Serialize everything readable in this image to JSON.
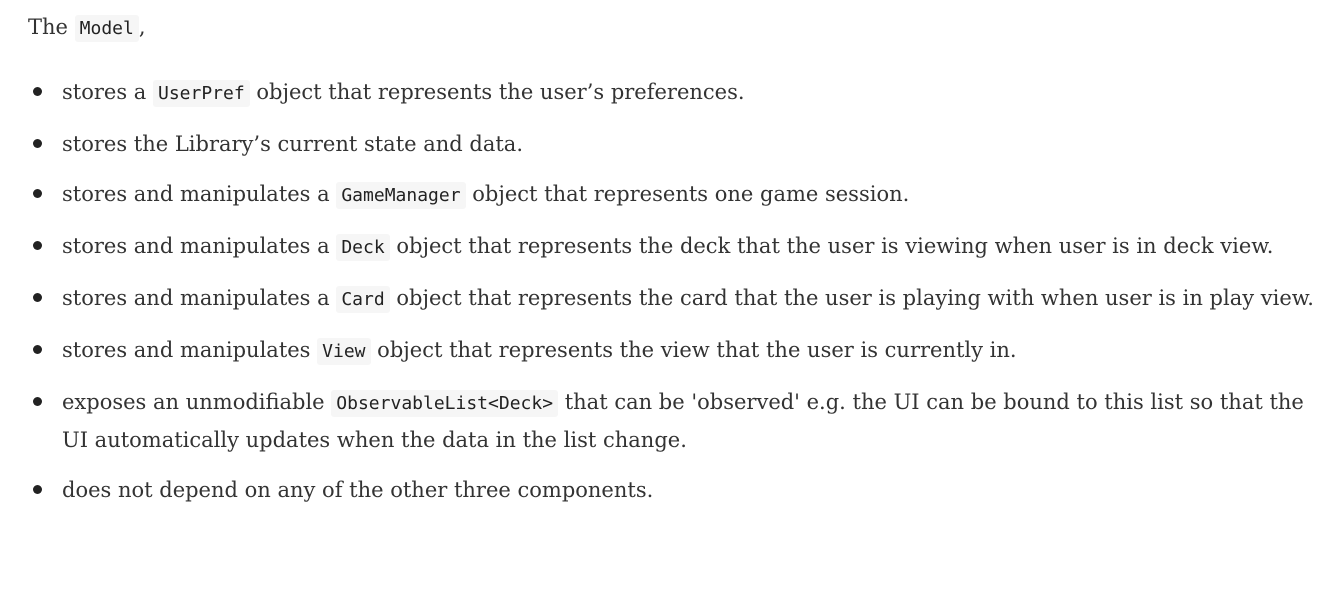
{
  "intro": {
    "before": "The ",
    "code": "Model",
    "after": ","
  },
  "items": [
    {
      "before": "stores a ",
      "code": "UserPref",
      "after": " object that represents the user’s preferences."
    },
    {
      "text": "stores the Library’s current state and data."
    },
    {
      "before": "stores and manipulates a ",
      "code": "GameManager",
      "after": " object that represents one game session."
    },
    {
      "before": "stores and manipulates a ",
      "code": "Deck",
      "after": " object that represents the deck that the user is viewing when user is in deck view."
    },
    {
      "before": "stores and manipulates a ",
      "code": "Card",
      "after": " object that represents the card that the user is playing with when user is in play view."
    },
    {
      "before": "stores and manipulates ",
      "code": "View",
      "after": " object that represents the view that the user is currently in."
    },
    {
      "before": "exposes an unmodifiable ",
      "code": "ObservableList<Deck>",
      "after": " that can be 'observed' e.g. the UI can be bound to this list so that the UI automatically updates when the data in the list change."
    },
    {
      "text": "does not depend on any of the other three components."
    }
  ]
}
